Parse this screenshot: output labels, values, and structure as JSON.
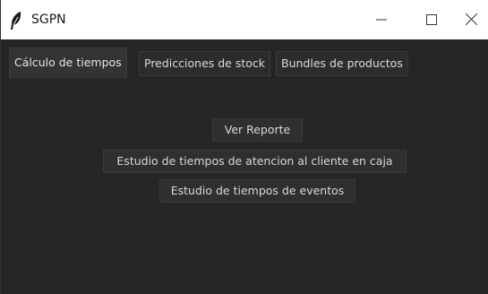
{
  "window": {
    "title": "SGPN",
    "app_icon": "feather-icon",
    "controls": {
      "minimize": "minimize-icon",
      "maximize": "maximize-icon",
      "close": "close-icon"
    }
  },
  "tabs": [
    {
      "label": "Cálculo de tiempos",
      "active": true
    },
    {
      "label": "Predicciones de stock",
      "active": false
    },
    {
      "label": "Bundles de productos",
      "active": false
    }
  ],
  "buttons": {
    "ver_reporte": "Ver Reporte",
    "estudio_caja": "Estudio de tiempos de atencion al cliente en caja",
    "estudio_eventos": "Estudio de tiempos de eventos"
  },
  "colors": {
    "background": "#252525",
    "titlebar": "#ffffff",
    "text": "#d8d8d8"
  }
}
